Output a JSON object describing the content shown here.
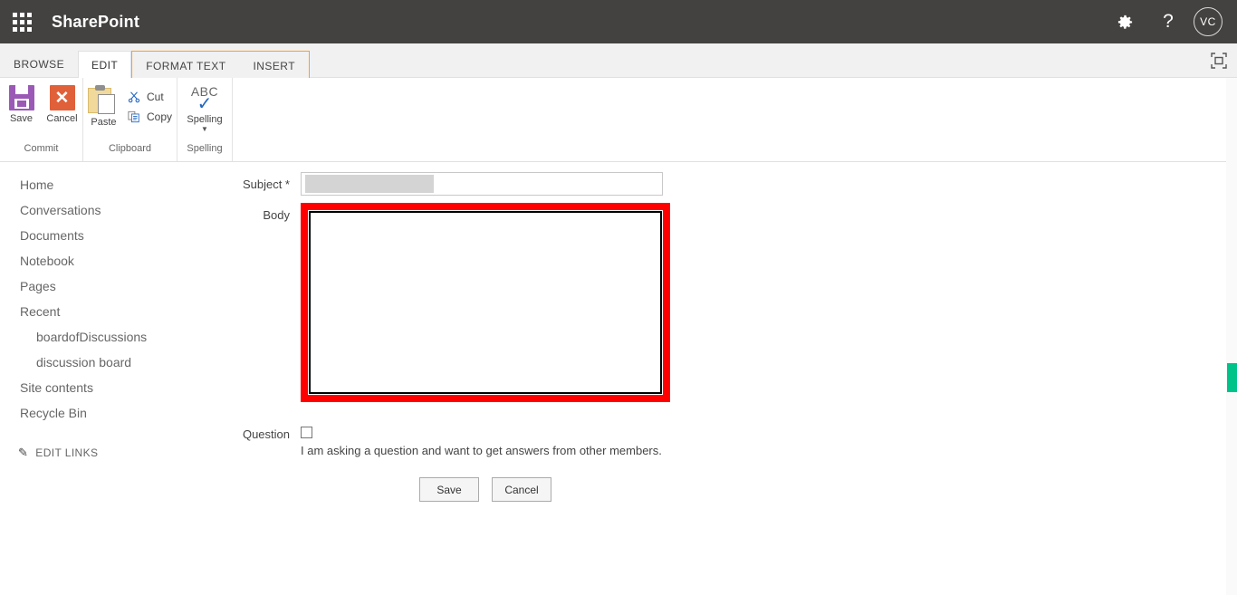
{
  "suite": {
    "app_launcher_icon": "waffle-grid-icon",
    "title": "SharePoint",
    "settings_icon": "gear-icon",
    "help_icon": "question-mark-icon",
    "avatar_initials": "VC",
    "brand_bg": "#444241"
  },
  "tabs": [
    {
      "label": "BROWSE",
      "active": false,
      "contextual": false
    },
    {
      "label": "EDIT",
      "active": true,
      "contextual": false
    },
    {
      "label": "FORMAT TEXT",
      "active": false,
      "contextual": true
    },
    {
      "label": "INSERT",
      "active": false,
      "contextual": true
    }
  ],
  "tabrow": {
    "focus_icon": "focus-on-content-icon",
    "contextual_accent": "#ff9e1f"
  },
  "ribbon": {
    "groups": [
      {
        "label": "Commit",
        "buttons": [
          {
            "label": "Save",
            "icon": "floppy-disk-icon",
            "color": "#9b59b6"
          },
          {
            "label": "Cancel",
            "icon": "x-cross-icon",
            "color": "#e0603a"
          }
        ]
      },
      {
        "label": "Clipboard",
        "buttons": [
          {
            "label": "Paste",
            "icon": "clipboard-icon"
          },
          {
            "label": "Cut",
            "icon": "scissors-icon"
          },
          {
            "label": "Copy",
            "icon": "copy-pages-icon"
          }
        ]
      },
      {
        "label": "Spelling",
        "buttons": [
          {
            "label": "Spelling",
            "icon": "abc-checkmark-icon",
            "top_text": "ABC"
          }
        ]
      }
    ]
  },
  "sidebar": {
    "items": [
      {
        "label": "Home",
        "sub": false
      },
      {
        "label": "Conversations",
        "sub": false
      },
      {
        "label": "Documents",
        "sub": false
      },
      {
        "label": "Notebook",
        "sub": false
      },
      {
        "label": "Pages",
        "sub": false
      },
      {
        "label": "Recent",
        "sub": false
      },
      {
        "label": "boardofDiscussions",
        "sub": true
      },
      {
        "label": "discussion board",
        "sub": true
      },
      {
        "label": "Site contents",
        "sub": false
      },
      {
        "label": "Recycle Bin",
        "sub": false
      }
    ],
    "edit_links": {
      "label": "EDIT LINKS",
      "icon": "pencil-icon"
    }
  },
  "form": {
    "subject": {
      "label": "Subject *",
      "value": "",
      "placeholder": ""
    },
    "body": {
      "label": "Body",
      "value": ""
    },
    "question": {
      "label": "Question",
      "checked": false,
      "description": "I am asking a question and want to get answers from other members."
    },
    "save_button": "Save",
    "cancel_button": "Cancel"
  },
  "highlight": {
    "color": "#ff0000",
    "target": "body-rich-text-editor"
  },
  "scrollbar": {
    "thumb_color": "#00c389"
  }
}
